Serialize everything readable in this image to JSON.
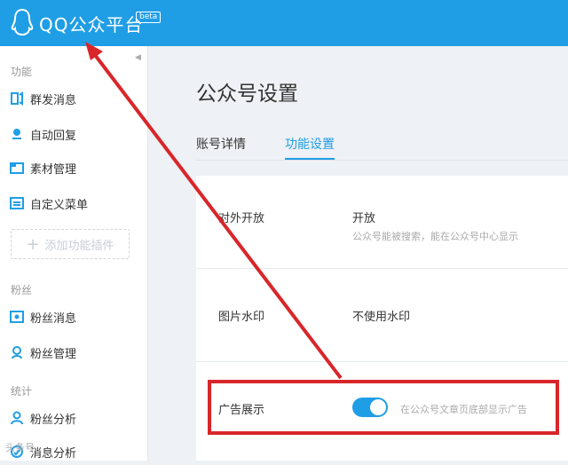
{
  "header": {
    "brand": "QQ公众平台",
    "badge": "beta"
  },
  "sidebar": {
    "sections": [
      {
        "title": "功能",
        "items": [
          {
            "label": "群发消息",
            "icon": "broadcast-icon"
          },
          {
            "label": "自动回复",
            "icon": "auto-reply-icon"
          },
          {
            "label": "素材管理",
            "icon": "material-icon"
          },
          {
            "label": "自定义菜单",
            "icon": "menu-icon"
          }
        ],
        "add_plugin": "添加功能插件"
      },
      {
        "title": "粉丝",
        "items": [
          {
            "label": "粉丝消息",
            "icon": "fan-message-icon"
          },
          {
            "label": "粉丝管理",
            "icon": "fan-manage-icon"
          }
        ]
      },
      {
        "title": "统计",
        "items": [
          {
            "label": "粉丝分析",
            "icon": "user-analysis-icon"
          },
          {
            "label": "消息分析",
            "icon": "message-analysis-icon"
          }
        ]
      }
    ]
  },
  "main": {
    "title": "公众号设置",
    "tabs": [
      {
        "label": "账号详情",
        "active": false
      },
      {
        "label": "功能设置",
        "active": true
      }
    ],
    "settings": [
      {
        "label": "对外开放",
        "value": "开放",
        "desc": "公众号能被搜索，能在公众号中心显示"
      },
      {
        "label": "图片水印",
        "value": "不使用水印"
      },
      {
        "label": "广告展示",
        "toggle": true,
        "desc": "在公众号文章页底部显示广告"
      }
    ]
  },
  "annotation": {
    "highlight_color": "#d8262a"
  },
  "watermark": "头条号"
}
